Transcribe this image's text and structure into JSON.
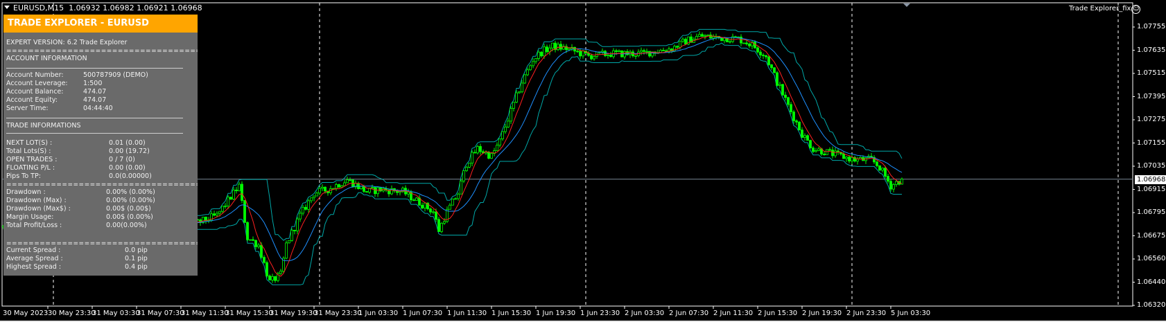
{
  "window": {
    "symbol_title": "EURUSD,M15",
    "ohlc": "1.06932 1.06982 1.06921 1.06968",
    "ea_name": "Trade Explorer_fix",
    "ea_icon": "smiley-icon",
    "current_price": "1.06968"
  },
  "panel": {
    "title": "TRADE EXPLORER - EURUSD",
    "version": "EXPERT VERSION: 6.2 Trade Explorer",
    "separator": "=========================================================",
    "account_header": "ACCOUNT INFORMATION",
    "account": [
      {
        "label": "Account Number:",
        "value": "500787909 (DEMO)"
      },
      {
        "label": "Account Leverage:",
        "value": "1:500"
      },
      {
        "label": "Account Balance:",
        "value": "474.07"
      },
      {
        "label": "Account Equity:",
        "value": "474.07"
      },
      {
        "label": "Server Time:",
        "value": "04:44:40"
      }
    ],
    "trade_header": "TRADE INFORMATIONS",
    "trade": [
      {
        "label": "NEXT LOT(S) :",
        "value": "0.01 (0.00)"
      },
      {
        "label": "Total Lots(S) :",
        "value": "0.00 (19.72)"
      },
      {
        "label": "OPEN TRADES :",
        "value": "0 / 7 (0)"
      },
      {
        "label": "FLOATING P/L :",
        "value": "0.00 (0.00)"
      },
      {
        "label": "Pips To TP:",
        "value": "0.0(0.00000)"
      }
    ],
    "drawdown": [
      {
        "label": "Drawdown :",
        "value": "0.00% (0.00%)"
      },
      {
        "label": "Drawdown (Max) :",
        "value": "0.00% (0.00%)"
      },
      {
        "label": "Drawdown (Max$) :",
        "value": "0.00$ (0.00$)"
      },
      {
        "label": "Margin Usage:",
        "value": "0.00$ (0.00%)"
      },
      {
        "label": "Total Profit/Loss :",
        "value": "0.00(0.00%)"
      }
    ],
    "spread": [
      {
        "label": "Current Spread :",
        "value": "0.0 pip"
      },
      {
        "label": "Average Spread :",
        "value": "0.1 pip"
      },
      {
        "label": "Highest Spread :",
        "value": "0.4 pip"
      }
    ]
  },
  "colors": {
    "bg": "#000000",
    "candle": "#00ff00",
    "ma_fast": "#ff2020",
    "ma_slow": "#1e90ff",
    "band": "#00a8a8",
    "accent": "#ffa500"
  },
  "chart_data": {
    "type": "candlestick",
    "timeframe": "M15",
    "y_ticks": [
      "1.07755",
      "1.07635",
      "1.07515",
      "1.07395",
      "1.07275",
      "1.07155",
      "1.07035",
      "1.06915",
      "1.06795",
      "1.06675",
      "1.06560",
      "1.06440",
      "1.06320"
    ],
    "ylim": [
      1.0632,
      1.07755
    ],
    "x_ticks": [
      "30 May 2023",
      "30 May 23:30",
      "31 May 03:30",
      "31 May 07:30",
      "31 May 11:30",
      "31 May 15:30",
      "31 May 19:30",
      "31 May 23:30",
      "1 Jun 03:30",
      "1 Jun 07:30",
      "1 Jun 11:30",
      "1 Jun 15:30",
      "1 Jun 19:30",
      "1 Jun 23:30",
      "2 Jun 03:30",
      "2 Jun 07:30",
      "2 Jun 11:30",
      "2 Jun 15:30",
      "2 Jun 19:30",
      "2 Jun 23:30",
      "5 Jun 03:30"
    ],
    "bars_per_tick": 16,
    "close_path": [
      [
        0,
        1.0672
      ],
      [
        70,
        1.06742
      ],
      [
        77,
        1.0678
      ],
      [
        85,
        1.06934
      ],
      [
        88,
        1.06665
      ],
      [
        92,
        1.06627
      ],
      [
        96,
        1.06435
      ],
      [
        100,
        1.06473
      ],
      [
        102,
        1.0663
      ],
      [
        107,
        1.0678
      ],
      [
        112,
        1.06896
      ],
      [
        117,
        1.06915
      ],
      [
        124,
        1.06965
      ],
      [
        131,
        1.06903
      ],
      [
        136,
        1.06915
      ],
      [
        144,
        1.06903
      ],
      [
        149,
        1.06857
      ],
      [
        155,
        1.068
      ],
      [
        157,
        1.06704
      ],
      [
        160,
        1.068
      ],
      [
        164,
        1.06896
      ],
      [
        167,
        1.07049
      ],
      [
        171,
        1.07126
      ],
      [
        176,
        1.07087
      ],
      [
        179,
        1.07164
      ],
      [
        183,
        1.07318
      ],
      [
        187,
        1.07471
      ],
      [
        191,
        1.07586
      ],
      [
        194,
        1.07625
      ],
      [
        198,
        1.07655
      ],
      [
        203,
        1.07644
      ],
      [
        211,
        1.07605
      ],
      [
        219,
        1.07617
      ],
      [
        230,
        1.07617
      ],
      [
        241,
        1.07644
      ],
      [
        246,
        1.07682
      ],
      [
        251,
        1.07709
      ],
      [
        257,
        1.07701
      ],
      [
        265,
        1.07694
      ],
      [
        270,
        1.07663
      ],
      [
        275,
        1.07605
      ],
      [
        279,
        1.07471
      ],
      [
        284,
        1.07318
      ],
      [
        288,
        1.07202
      ],
      [
        292,
        1.07126
      ],
      [
        297,
        1.07107
      ],
      [
        302,
        1.07087
      ],
      [
        307,
        1.07068
      ],
      [
        313,
        1.07068
      ],
      [
        316,
        1.0703
      ],
      [
        320,
        1.06934
      ],
      [
        324,
        1.06968
      ]
    ],
    "last_close": 1.06968
  }
}
